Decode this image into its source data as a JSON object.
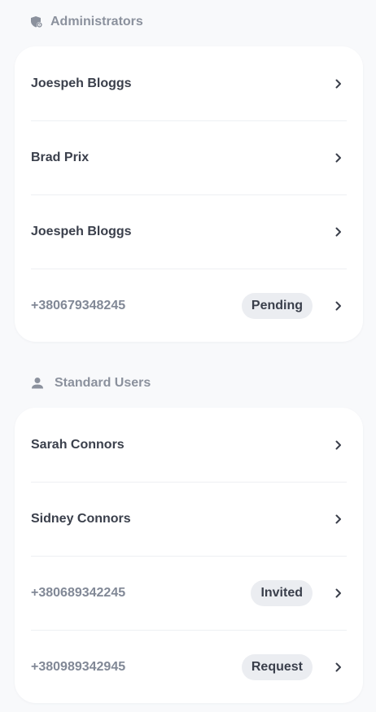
{
  "colors": {
    "page_background": "#f8f9fb",
    "card_background": "#ffffff",
    "header_text": "#8b919d",
    "name_text": "#3a3f4b",
    "phone_text": "#818896",
    "badge_background": "#ebedf1",
    "divider": "#eef0f3"
  },
  "administrators": {
    "title": "Administrators",
    "icon": "shield-gear-icon",
    "rows": [
      {
        "label": "Joespeh Bloggs",
        "badge": ""
      },
      {
        "label": "Brad Prix",
        "badge": ""
      },
      {
        "label": "Joespeh Bloggs",
        "badge": ""
      },
      {
        "label": "+380679348245",
        "badge": "Pending"
      }
    ]
  },
  "standard_users": {
    "title": "Standard Users",
    "icon": "person-icon",
    "rows": [
      {
        "label": "Sarah Connors",
        "badge": ""
      },
      {
        "label": "Sidney Connors",
        "badge": ""
      },
      {
        "label": "+380689342245",
        "badge": "Invited"
      },
      {
        "label": "+380989342945",
        "badge": "Request"
      }
    ]
  }
}
